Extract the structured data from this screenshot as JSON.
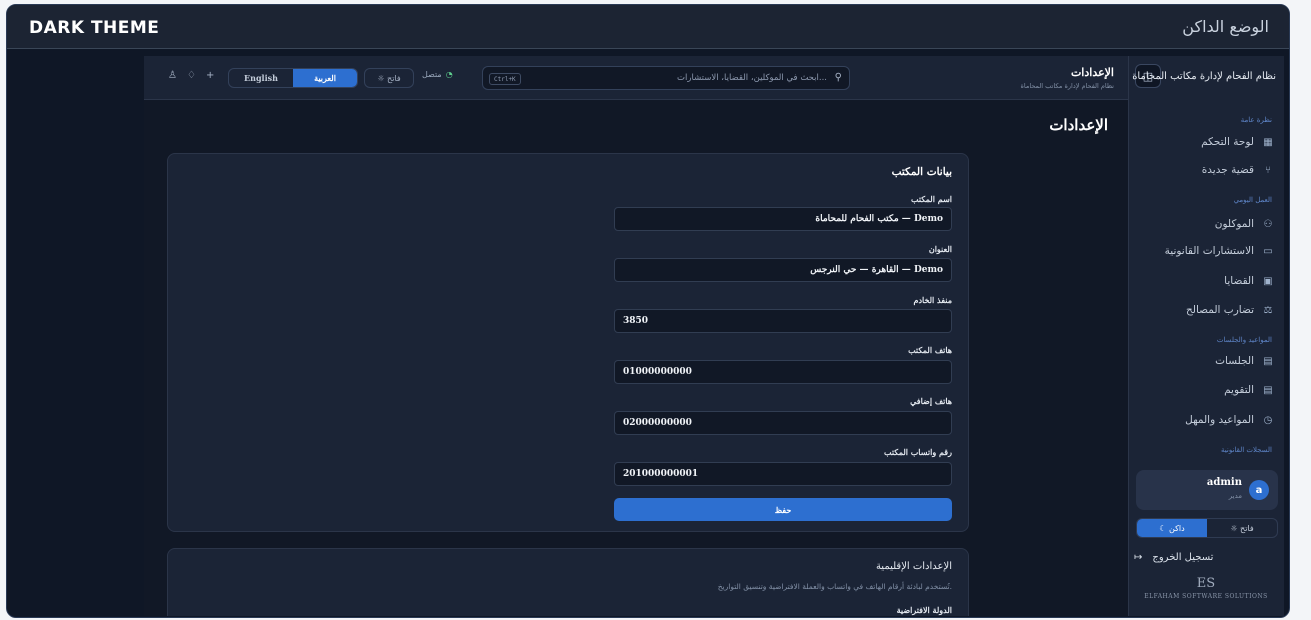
{
  "frame": {
    "title": "DARK THEME",
    "title_ar": "الوضع الداكن"
  },
  "sidebar": {
    "brand": "نظام الفحام لإدارة مكاتب المحاماة",
    "groups": {
      "main": "نظرة عامة",
      "work": "العمل اليومي",
      "schedule": "المواعيد والجلسات",
      "records": "السجلات القانونية"
    },
    "items": [
      {
        "label": "لوحة التحكم",
        "icon": "grid-icon"
      },
      {
        "label": "قضية جديدة",
        "icon": "git-branch-icon"
      },
      {
        "label": "الموكلون",
        "icon": "users-icon"
      },
      {
        "label": "الاستشارات القانونية",
        "icon": "messages-icon"
      },
      {
        "label": "القضايا",
        "icon": "briefcase-icon"
      },
      {
        "label": "تضارب المصالح",
        "icon": "scale-icon"
      },
      {
        "label": "الجلسات",
        "icon": "calendar-icon"
      },
      {
        "label": "التقويم",
        "icon": "calendar-icon"
      },
      {
        "label": "المواعيد والمهل",
        "icon": "clock-icon"
      }
    ],
    "user": {
      "name": "admin",
      "role": "مدير",
      "initial": "a"
    },
    "theme": {
      "light": "☼ فاتح",
      "dark": "☾ داكن"
    },
    "logout": "تسجيل الخروج",
    "footer": {
      "mark": "ES",
      "company": "ELFAHAM SOFTWARE SOLUTIONS"
    }
  },
  "topbar": {
    "title": "الإعدادات",
    "subtitle": "نظام الفحام لإدارة مكاتب المحاماة",
    "search_placeholder": "ابحث في الموكلين، القضايا، الاستشارات...",
    "search_kbd": "Ctrl+K",
    "status": "متصل",
    "light_label": "☼ فاتح",
    "lang_ar": "العربية",
    "lang_en": "English"
  },
  "main": {
    "page_title": "الإعدادات",
    "office_card": {
      "title": "بيانات المكتب",
      "fields": [
        {
          "label": "اسم المكتب",
          "value": "مكتب الفحام للمحاماة — Demo"
        },
        {
          "label": "العنوان",
          "value": "القاهرة — حي النرجس — Demo"
        },
        {
          "label": "منفذ الخادم",
          "value": "3850"
        },
        {
          "label": "هاتف المكتب",
          "value": "01000000000"
        },
        {
          "label": "هاتف إضافي",
          "value": "02000000000"
        },
        {
          "label": "رقم واتساب المكتب",
          "value": "201000000001"
        }
      ],
      "save": "حفظ"
    },
    "regional_card": {
      "title": "الإعدادات الإقليمية",
      "subtitle": "تُستخدم لبادئة أرقام الهاتف في واتساب والعملة الافتراضية وتنسيق التواريخ.",
      "country_label": "الدولة الافتراضية"
    }
  },
  "colors": {
    "accent": "#2d6fd0",
    "background": "#111826",
    "panel": "#1b2436",
    "online": "#5fcf8f"
  }
}
